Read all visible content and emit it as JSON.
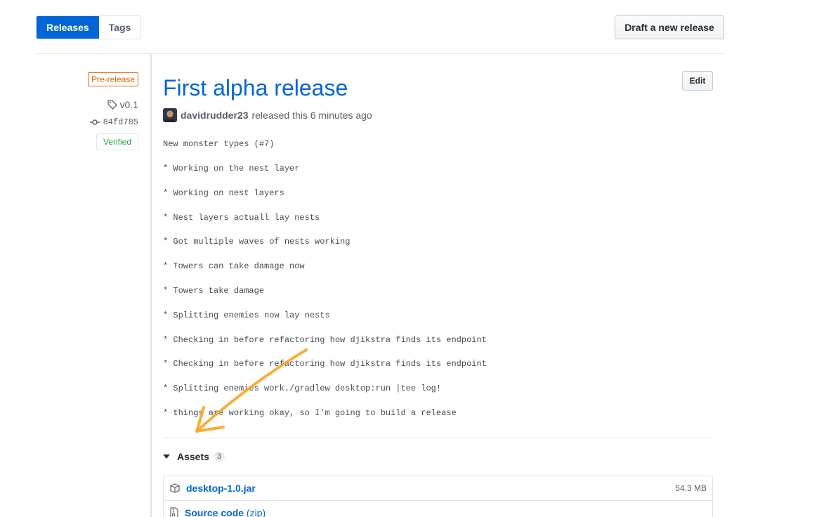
{
  "tabs": {
    "releases": "Releases",
    "tags": "Tags"
  },
  "draft_button": "Draft a new release",
  "meta": {
    "badge": "Pre-release",
    "tag": "v0.1",
    "commit": "84fd785",
    "verified": "Verified"
  },
  "release": {
    "title": "First alpha release",
    "edit": "Edit",
    "author": "davidrudder23",
    "released_text": "released this 6 minutes ago",
    "notes": [
      "New monster types (#7)",
      "* Working on the nest layer",
      "* Working on nest layers",
      "* Nest layers actuall lay nests",
      "* Got multiple waves of nests working",
      "* Towers can take damage now",
      "* Towers take damage",
      "* Splitting enemies now lay nests",
      "* Checking in before refactoring how djikstra finds its endpoint",
      "* Checking in before refactoring how djikstra finds its endpoint",
      "* Splitting enemies work./gradlew desktop:run |tee log!",
      "* things are working okay, so I'm going to build a release"
    ]
  },
  "assets": {
    "label": "Assets",
    "count": "3",
    "items": [
      {
        "name": "desktop-1.0.jar",
        "size": "54.3 MB"
      },
      {
        "name": "Source code",
        "suffix": "(zip)"
      }
    ]
  },
  "colors": {
    "link": "#0366d6",
    "prerelease": "#e36209",
    "verified": "#28a745",
    "annotation_arrow": "#f5a623"
  },
  "icons": [
    "tag-icon",
    "git-commit-icon",
    "package-icon",
    "file-zip-icon",
    "triangle-down-icon"
  ]
}
